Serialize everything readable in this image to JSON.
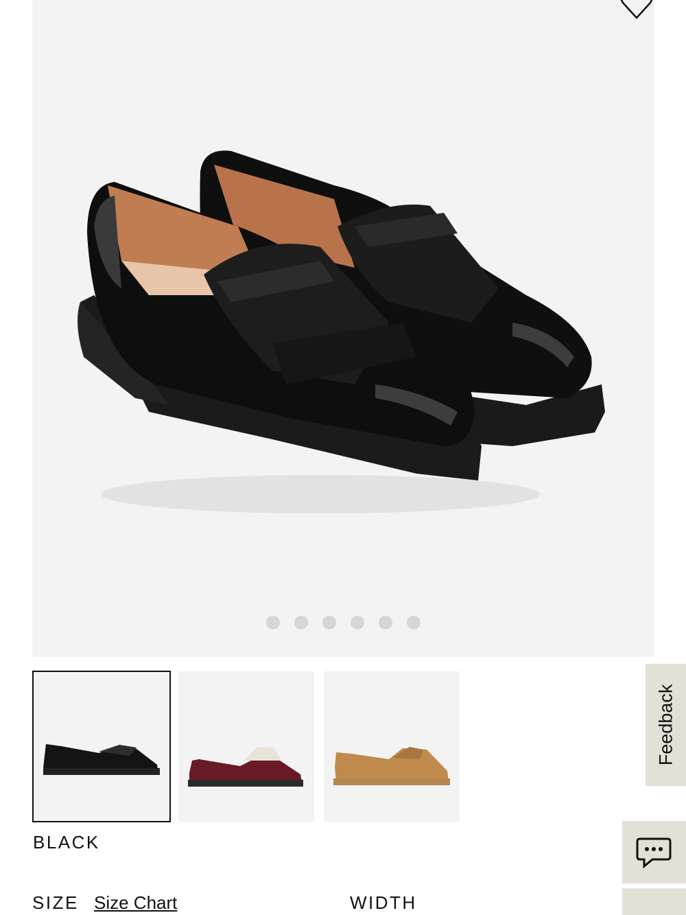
{
  "product": {
    "selected_color": "BLACK",
    "image_count": 6,
    "active_image_index": 0
  },
  "swatches": [
    {
      "color_name": "Black",
      "shoe_color": "#141414",
      "selected": true
    },
    {
      "color_name": "Burgundy / Ivory",
      "shoe_color": "#6a1a26",
      "selected": false
    },
    {
      "color_name": "Tan Suede",
      "shoe_color": "#c08a4c",
      "selected": false
    }
  ],
  "size": {
    "label": "SIZE",
    "chart_link": "Size Chart"
  },
  "width": {
    "label": "WIDTH"
  },
  "feedback": {
    "label": "Feedback"
  },
  "icons": {
    "wishlist": "heart-outline-icon",
    "chat": "chat-bubble-icon"
  },
  "colors": {
    "image_bg": "#f3f3f3",
    "dot": "#d6d6d6",
    "tab_bg": "#e3e0d6"
  }
}
